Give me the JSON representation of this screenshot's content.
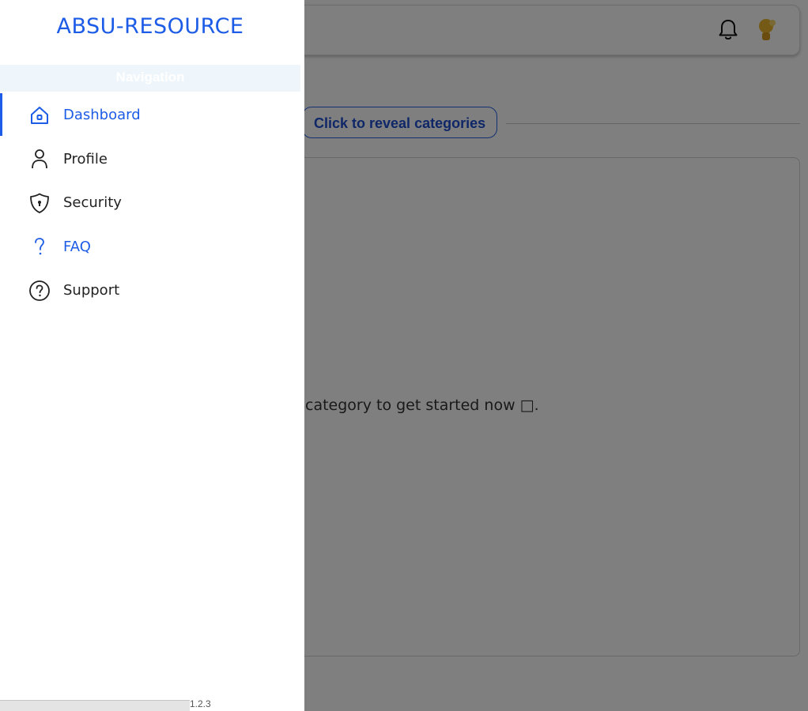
{
  "app": {
    "brand": "ABSU-RESOURCE"
  },
  "nav": {
    "header": "Navigation",
    "items": [
      {
        "label": "Dashboard",
        "icon": "home-icon",
        "active": true
      },
      {
        "label": "Profile",
        "icon": "user-icon"
      },
      {
        "label": "Security",
        "icon": "shield-icon"
      },
      {
        "label": "FAQ",
        "icon": "question-mark-icon"
      },
      {
        "label": "Support",
        "icon": "help-circle-icon"
      }
    ]
  },
  "footer": {
    "version": "1.2.3"
  },
  "main": {
    "reveal_label": "Click to reveal categories",
    "empty_text": "category to get started now □."
  },
  "colors": {
    "accent": "#1d5ce6",
    "nav_header_bg": "#eef6fb",
    "overlay": "rgba(0,0,0,0.5)"
  }
}
